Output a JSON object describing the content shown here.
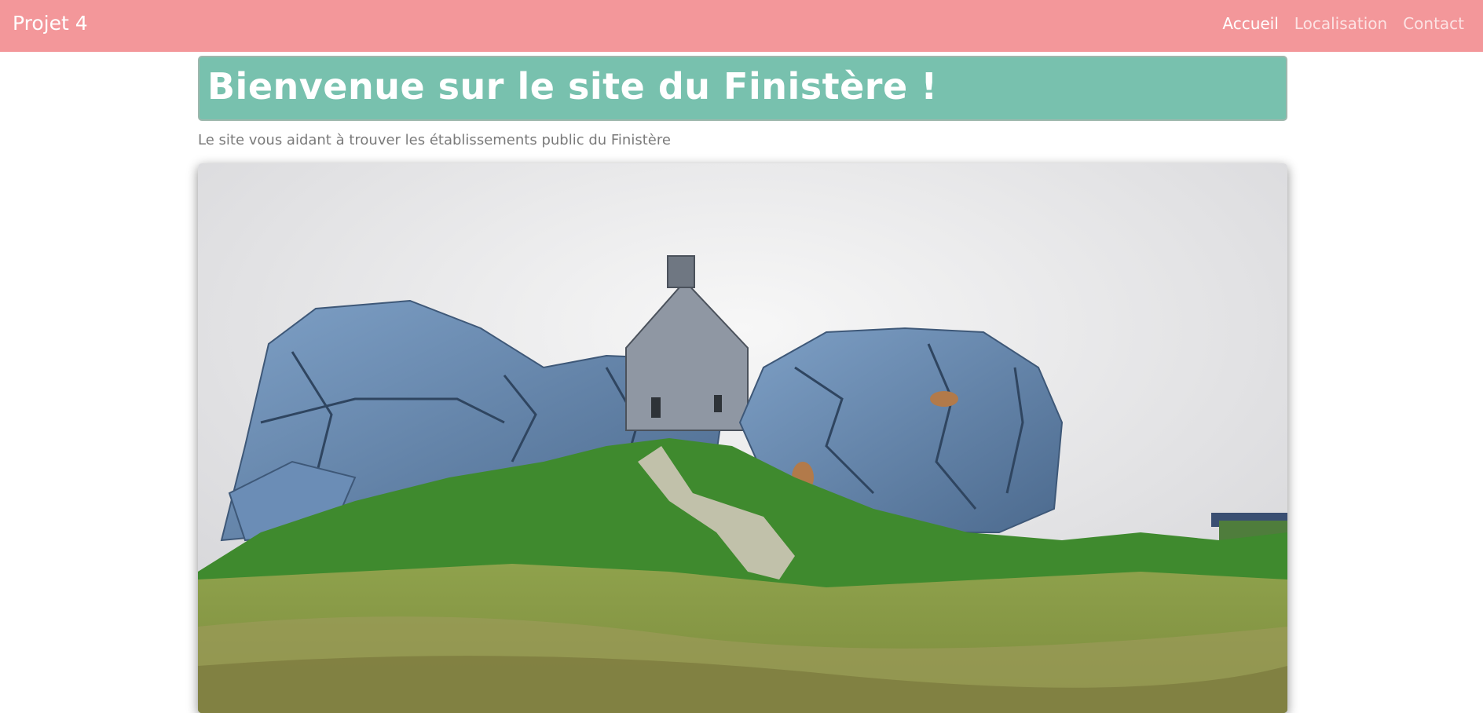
{
  "navbar": {
    "brand": "Projet 4",
    "links": [
      {
        "label": "Accueil",
        "active": true
      },
      {
        "label": "Localisation",
        "active": false
      },
      {
        "label": "Contact",
        "active": false
      }
    ],
    "background": "#f3979a"
  },
  "header": {
    "title": "Bienvenue sur le site du Finistère !",
    "background": "#78c1ae"
  },
  "main": {
    "subtitle": "Le site vous aidant à trouver les établissements public du Finistère"
  }
}
